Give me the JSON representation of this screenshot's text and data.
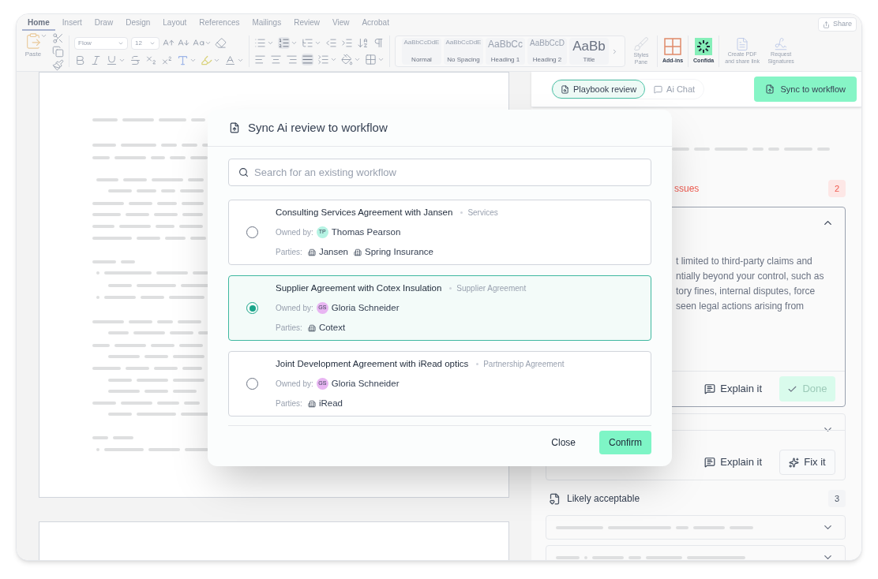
{
  "ribbon": {
    "tabs": [
      {
        "label": "Home",
        "selected": true
      },
      {
        "label": "Insert",
        "selected": false
      },
      {
        "label": "Draw",
        "selected": false
      },
      {
        "label": "Design",
        "selected": false
      },
      {
        "label": "Layout",
        "selected": false
      },
      {
        "label": "References",
        "selected": false
      },
      {
        "label": "Mailings",
        "selected": false
      },
      {
        "label": "Review",
        "selected": false
      },
      {
        "label": "View",
        "selected": false
      },
      {
        "label": "Acrobat",
        "selected": false
      }
    ],
    "share": "Share",
    "paste": "Paste",
    "font": "Flow",
    "size": "12",
    "styles": [
      {
        "preview": "AaBbCcDdE",
        "name": "Normal",
        "kind": "body"
      },
      {
        "preview": "AaBbCcDdE",
        "name": "No Spacing",
        "kind": "body"
      },
      {
        "preview": "AaBbCc",
        "name": "Heading 1",
        "kind": "heading"
      },
      {
        "preview": "AaBbCcD",
        "name": "Heading 2",
        "kind": "subheading"
      },
      {
        "preview": "AaBb",
        "name": "Title",
        "kind": "title"
      }
    ],
    "styles_pane": "Styles Pane",
    "addins": "Add-ins",
    "confida": "Confida",
    "create_pdf": "Create PDF and share link",
    "request_signatures": "Request Signatures"
  },
  "side_panel": {
    "tabs": [
      {
        "label": "Playbook review",
        "selected": true
      },
      {
        "label": "Ai Chat",
        "selected": false
      }
    ],
    "sync_button": "Sync to workflow",
    "issues": {
      "title": "ssues",
      "count": "2"
    },
    "issue_text": [
      "t limited to third-party claims and",
      "ntially beyond your control, such as",
      "tory fines, internal disputes, force",
      "seen legal actions arising from"
    ],
    "cards": [
      {
        "expanded": true,
        "actions": [
          {
            "kind": "explain",
            "label": "Explain it"
          },
          {
            "kind": "done",
            "label": "Done"
          }
        ]
      },
      {
        "expanded": false,
        "actions": [
          {
            "kind": "explain",
            "label": "Explain it"
          },
          {
            "kind": "fix",
            "label": "Fix it"
          }
        ]
      }
    ],
    "acceptable": {
      "title": "Likely acceptable",
      "count": "3"
    }
  },
  "dialog": {
    "title": "Sync Ai review to workflow",
    "search": {
      "placeholder": "Search for an existing workflow"
    },
    "workflows": [
      {
        "title": "Consulting Services Agreement with Jansen",
        "type": "Services",
        "owner_label": "Owned by:",
        "owner": {
          "initials": "TP",
          "name": "Thomas Pearson",
          "color": "#b5f3e3"
        },
        "parties_label": "Parties:",
        "parties": [
          "Jansen",
          "Spring Insurance"
        ],
        "selected": false
      },
      {
        "title": "Supplier Agreement with Cotex Insulation",
        "type": "Supplier Agreement",
        "owner_label": "Owned by:",
        "owner": {
          "initials": "GS",
          "name": "Gloria Schneider",
          "color": "#e8b5f2"
        },
        "parties_label": "Parties:",
        "parties": [
          "Cotext"
        ],
        "selected": true
      },
      {
        "title": "Joint Development Agreement with iRead optics",
        "type": "Partnership Agreement",
        "owner_label": "Owned by:",
        "owner": {
          "initials": "GS",
          "name": "Gloria Schneider",
          "color": "#e8b5f2"
        },
        "parties_label": "Parties:",
        "parties": [
          "iRead"
        ],
        "selected": false
      }
    ],
    "close": "Close",
    "confirm": "Confirm"
  }
}
